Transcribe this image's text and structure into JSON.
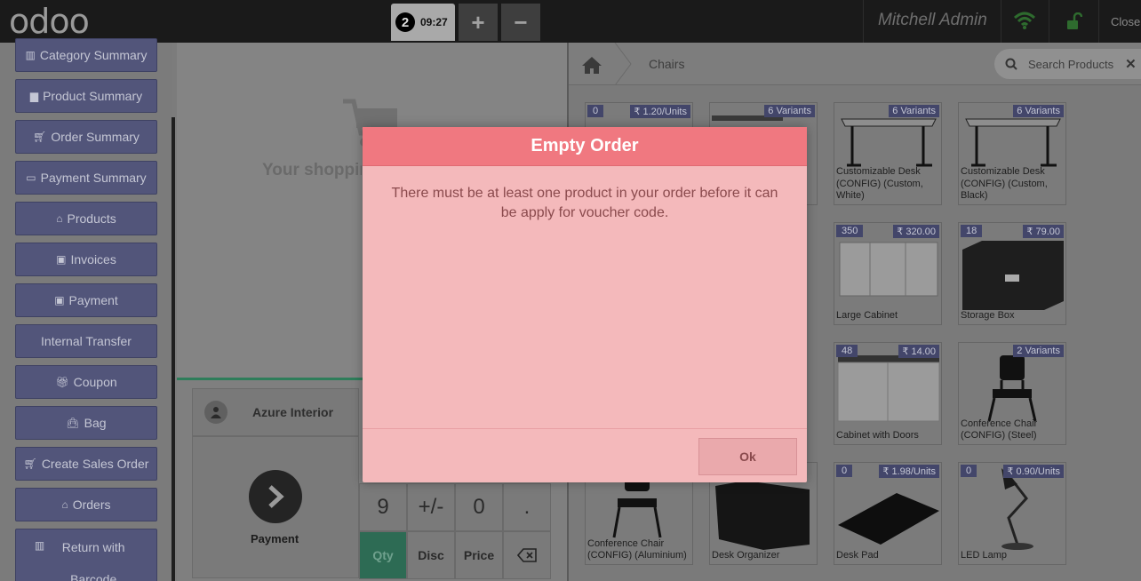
{
  "topbar": {
    "logo": "odoo",
    "order_number": "2",
    "order_time": "09:27",
    "add_label": "+",
    "remove_label": "−",
    "username": "Mitchell Admin",
    "close_label": "Close"
  },
  "sidebar": {
    "items": [
      {
        "label": "Category Summary",
        "icon": "bar-chart-icon"
      },
      {
        "label": "Product Summary",
        "icon": "file-icon"
      },
      {
        "label": "Order Summary",
        "icon": "cart-icon"
      },
      {
        "label": "Payment Summary",
        "icon": "credit-card-icon"
      },
      {
        "label": "Products",
        "icon": "bank-icon"
      },
      {
        "label": "Invoices",
        "icon": "money-icon"
      },
      {
        "label": "Payment",
        "icon": "money-icon"
      },
      {
        "label": "Internal Transfer",
        "icon": ""
      },
      {
        "label": "Coupon",
        "icon": "gift-icon"
      },
      {
        "label": "Bag",
        "icon": "bag-icon"
      },
      {
        "label": "Create Sales Order",
        "icon": "cart-icon"
      },
      {
        "label": "Orders",
        "icon": "bank-icon"
      },
      {
        "label": "Return with Barcode",
        "icon": "barcode-icon"
      }
    ]
  },
  "order": {
    "empty_text": "Your shopping cart is empty"
  },
  "customer": {
    "name": "Azure Interior"
  },
  "payment": {
    "label": "Payment"
  },
  "numpad": {
    "keys": [
      "9",
      "+/-",
      "0",
      ".",
      "Qty",
      "Disc",
      "Price"
    ],
    "active_mode": "Qty"
  },
  "products": {
    "breadcrumb": "Chairs",
    "search_placeholder": "Search Products",
    "tiles": [
      {
        "left_badge": "0",
        "right_badge": "₹ 1.20/Units",
        "name": ""
      },
      {
        "left_badge": "",
        "right_badge": "6 Variants",
        "name": ""
      },
      {
        "left_badge": "",
        "right_badge": "6 Variants",
        "name": "Customizable Desk (CONFIG) (Custom, White)"
      },
      {
        "left_badge": "",
        "right_badge": "6 Variants",
        "name": "Customizable Desk (CONFIG) (Custom, Black)"
      },
      {
        "left_badge": "350",
        "right_badge": "₹ 320.00",
        "name": "Large Cabinet"
      },
      {
        "left_badge": "18",
        "right_badge": "₹ 79.00",
        "name": "Storage Box"
      },
      {
        "left_badge": "48",
        "right_badge": "₹ 14.00",
        "name": "Cabinet with Doors"
      },
      {
        "left_badge": "",
        "right_badge": "2 Variants",
        "name": "Conference Chair (CONFIG) (Steel)"
      },
      {
        "left_badge": "",
        "right_badge": "",
        "name": "Conference Chair (CONFIG) (Aluminium)"
      },
      {
        "left_badge": "",
        "right_badge": "",
        "name": "Desk Organizer"
      },
      {
        "left_badge": "0",
        "right_badge": "₹ 1.98/Units",
        "name": "Desk Pad"
      },
      {
        "left_badge": "0",
        "right_badge": "₹ 0.90/Units",
        "name": "LED Lamp"
      }
    ]
  },
  "modal": {
    "title": "Empty Order",
    "message": "There must be at least one product in your order before it can be apply for voucher code.",
    "ok_label": "Ok"
  },
  "colors": {
    "modal_header": "#f07880",
    "modal_body": "#f4b9bb",
    "sidebar_button": "#52557a",
    "qty_active": "#2d6b54"
  }
}
